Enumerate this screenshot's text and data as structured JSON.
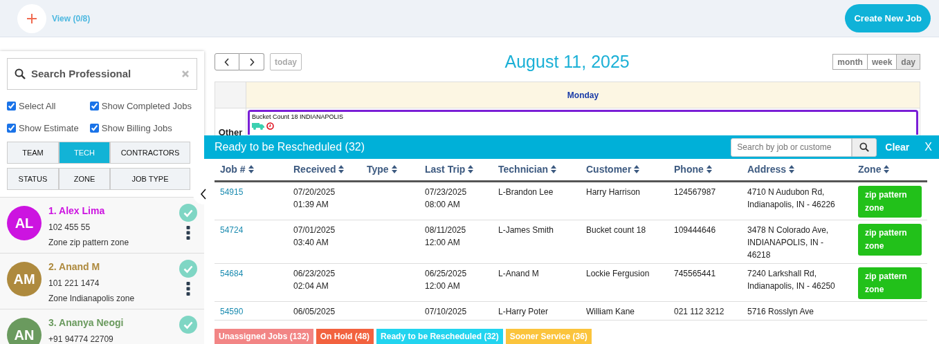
{
  "header": {
    "view_label": "View (0/8)",
    "create_button": "Create New Job"
  },
  "sidebar": {
    "search": {
      "placeholder": "Search Professional"
    },
    "options": [
      {
        "label": "Select All",
        "checked": true
      },
      {
        "label": "Show Completed Jobs",
        "checked": true
      },
      {
        "label": "Show Estimate",
        "checked": true
      },
      {
        "label": "Show Billing Jobs",
        "checked": true
      }
    ],
    "filter_tabs": [
      {
        "label": "TEAM",
        "selected": false
      },
      {
        "label": "TECH",
        "selected": true
      },
      {
        "label": "CONTRACTORS",
        "selected": false
      },
      {
        "label": "STATUS",
        "selected": false
      },
      {
        "label": "ZONE",
        "selected": false
      },
      {
        "label": "JOB TYPE",
        "selected": false
      }
    ],
    "professionals": [
      {
        "initials": "AL",
        "name": "1. Alex Lima",
        "phone": "102 455 55",
        "zone": "Zone zip pattern zone",
        "color": "#cc14e0"
      },
      {
        "initials": "AM",
        "name": "2. Anand M",
        "phone": "101 221 1474",
        "zone": "Zone Indianapolis zone",
        "color": "#ae8a3e"
      },
      {
        "initials": "AN",
        "name": "3. Ananya Neogi",
        "phone": "+91 94774 22709",
        "color": "#6a9a5e"
      }
    ]
  },
  "calendar": {
    "today": "today",
    "title": "August 11, 2025",
    "views": [
      {
        "label": "month",
        "selected": false
      },
      {
        "label": "week",
        "selected": false
      },
      {
        "label": "day",
        "selected": true
      }
    ],
    "day_header": "Monday",
    "row_label": "Other",
    "events": [
      {
        "title": "Bucket Count 18 INDIANAPOLIS"
      }
    ]
  },
  "panel": {
    "title": "Ready to be Rescheduled (32)",
    "search": {
      "placeholder": "Search by job or custome"
    },
    "clear": "Clear",
    "close": "X",
    "columns": [
      "Job #",
      "Received",
      "Type",
      "Last Trip",
      "Technician",
      "Customer",
      "Phone",
      "Address",
      "Zone"
    ],
    "rows": [
      {
        "job": "54915",
        "received": [
          "07/20/2025",
          "01:39 AM"
        ],
        "type": "",
        "last_trip": [
          "07/23/2025",
          "08:00 AM"
        ],
        "technician": "L-Brandon Lee",
        "customer": "Harry Harrison",
        "phone": "124567987",
        "address": "4710 N Audubon Rd, Indianapolis, IN - 46226",
        "zone": "zip pattern zone"
      },
      {
        "job": "54724",
        "received": [
          "07/01/2025",
          "03:40 AM"
        ],
        "type": "",
        "last_trip": [
          "08/11/2025",
          "12:00 AM"
        ],
        "technician": "L-James Smith",
        "customer": "Bucket count 18",
        "phone": "109444646",
        "address": "3478 N Colorado Ave, INDIANAPOLIS, IN - 46218",
        "zone": "zip pattern zone"
      },
      {
        "job": "54684",
        "received": [
          "06/23/2025",
          "02:04 AM"
        ],
        "type": "",
        "last_trip": [
          "06/25/2025",
          "12:00 AM"
        ],
        "technician": "L-Anand M",
        "customer": "Lockie Fergusion",
        "phone": "745565441",
        "address": "7240 Larkshall Rd, Indianapolis, IN - 46250",
        "zone": "zip pattern zone"
      },
      {
        "job": "54590",
        "received": [
          "06/05/2025"
        ],
        "type": "",
        "last_trip": [
          "07/10/2025"
        ],
        "technician": "L-Harry Poter",
        "customer": "William Kane",
        "phone": "021 112 3212",
        "address": "5716 Rosslyn Ave"
      }
    ]
  },
  "queue_tabs": [
    {
      "label": "Unassigned Jobs (132)",
      "color": "#f28585"
    },
    {
      "label": "On Hold (48)",
      "color": "#f2623f"
    },
    {
      "label": "Ready to be Rescheduled (32)",
      "color": "#22d4ef"
    },
    {
      "label": "Sooner Service (36)",
      "color": "#fbc43c"
    }
  ]
}
